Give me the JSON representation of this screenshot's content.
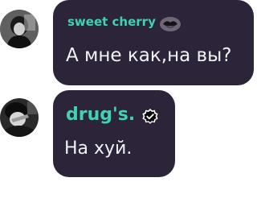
{
  "messages": [
    {
      "author": "sweet cherry",
      "badge_icon": "lips-icon",
      "text": "А мне как,на вы?"
    },
    {
      "author": "drug's.",
      "badge_icon": "verified-check-icon",
      "text": "На хуй."
    }
  ],
  "colors": {
    "bubble": "#2c2438",
    "author": "#3fd3b2",
    "text": "#f2f2f4"
  }
}
